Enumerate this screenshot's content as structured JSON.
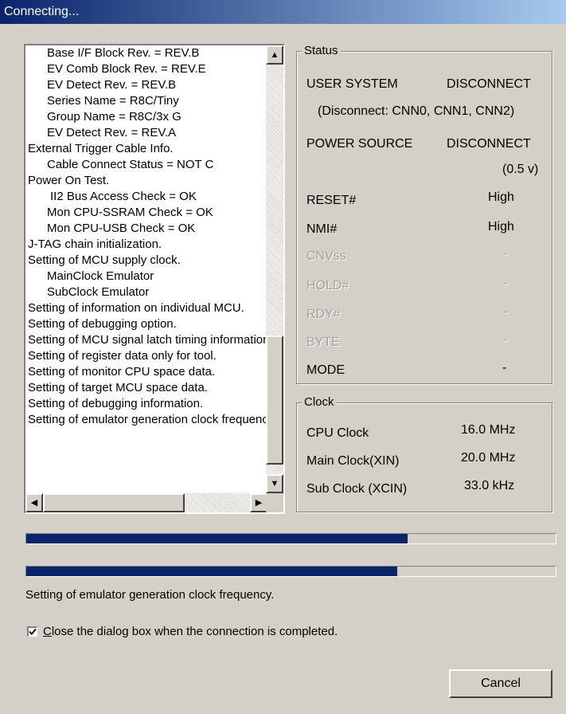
{
  "window": {
    "title": "Connecting..."
  },
  "log": {
    "lines": [
      {
        "text": "Base I/F Block Rev.     = REV.B",
        "indent": 1
      },
      {
        "text": "EV Comb Block Rev.      = REV.E",
        "indent": 1
      },
      {
        "text": "EV Detect Rev.          = REV.B",
        "indent": 1
      },
      {
        "text": "Series Name             = R8C/Tiny",
        "indent": 1
      },
      {
        "text": "Group Name              = R8C/3x G",
        "indent": 1
      },
      {
        "text": "EV Detect Rev.          = REV.A",
        "indent": 1
      },
      {
        "text": "External Trigger Cable Info.",
        "indent": 0
      },
      {
        "text": "Cable Connect Status  = NOT C",
        "indent": 1
      },
      {
        "text": "Power On Test.",
        "indent": 0
      },
      {
        "text": "II2 Bus Access Check   = OK",
        "indent": 2
      },
      {
        "text": "Mon CPU-SSRAM Check    = OK",
        "indent": 1
      },
      {
        "text": "Mon CPU-USB Check      = OK",
        "indent": 1
      },
      {
        "text": "J-TAG chain initialization.",
        "indent": 0
      },
      {
        "text": "Setting of MCU supply clock.",
        "indent": 0
      },
      {
        "text": "MainClock  Emulator",
        "indent": 1
      },
      {
        "text": "SubClock  Emulator",
        "indent": 1
      },
      {
        "text": "Setting of information on individual MCU.",
        "indent": 0
      },
      {
        "text": "Setting of debugging option.",
        "indent": 0
      },
      {
        "text": "Setting of MCU signal latch timing information.",
        "indent": 0
      },
      {
        "text": "Setting of register data only for tool.",
        "indent": 0
      },
      {
        "text": "Setting of monitor CPU space data.",
        "indent": 0
      },
      {
        "text": "Setting of target MCU space data.",
        "indent": 0
      },
      {
        "text": "Setting of debugging information.",
        "indent": 0
      },
      {
        "text": "Setting of emulator generation clock frequency.",
        "indent": 0
      }
    ],
    "scroll_up_glyph": "▲",
    "scroll_down_glyph": "▼",
    "scroll_left_glyph": "◀",
    "scroll_right_glyph": "▶"
  },
  "status": {
    "title": "Status",
    "user_system_label": "USER SYSTEM",
    "user_system_value": "DISCONNECT",
    "user_system_detail": "(Disconnect: CNN0, CNN1, CNN2)",
    "power_source_label": "POWER SOURCE",
    "power_source_value": "DISCONNECT",
    "power_source_voltage": "(0.5 v)",
    "reset_label": "RESET#",
    "reset_value": "High",
    "nmi_label": "NMI#",
    "nmi_value": "High",
    "cnvss_label": "CNVss",
    "cnvss_value": "-",
    "hold_label": "HOLD#",
    "hold_value": "-",
    "rdy_label": "RDY#",
    "rdy_value": "-",
    "byte_label": "BYTE",
    "byte_value": "-",
    "mode_label": "MODE",
    "mode_value": "-"
  },
  "clock": {
    "title": "Clock",
    "cpu_label": "CPU Clock",
    "cpu_value": "16.0 MHz",
    "main_label": "Main Clock(XIN)",
    "main_value": "20.0 MHz",
    "sub_label": "Sub Clock (XCIN)",
    "sub_value": "33.0 kHz"
  },
  "progress": {
    "bar1": 0.72,
    "bar2": 0.7
  },
  "status_message": "Setting of emulator generation clock frequency.",
  "close_checkbox": {
    "checked": true,
    "underlined_letter": "C",
    "label_rest": "lose the dialog box when the connection is completed."
  },
  "cancel_button": "Cancel",
  "colors": {
    "title_start": "#0a246a",
    "title_end": "#a6caf0",
    "face": "#d4d0c8",
    "progress": "#0a246a"
  }
}
